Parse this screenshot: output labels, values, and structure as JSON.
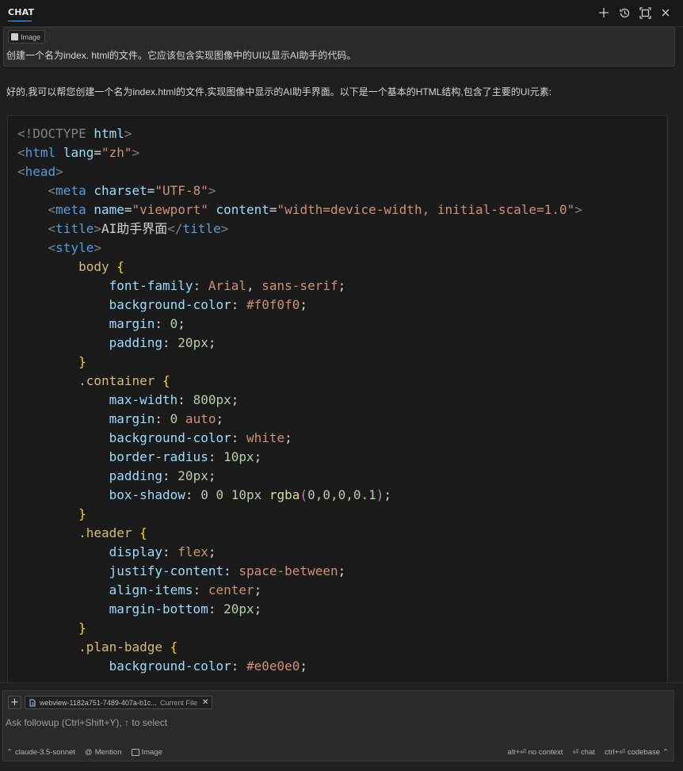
{
  "header": {
    "title": "CHAT"
  },
  "user_message": {
    "attachment_label": "Image",
    "text": "创建一个名为index. html的文件。它应该包含实现图像中的UI以显示AI助手的代码。"
  },
  "assistant": {
    "intro": "好的,我可以帮您创建一个名为index.html的文件,实现图像中显示的AI助手界面。以下是一个基本的HTML结构,包含了主要的UI元素:"
  },
  "code_lines": [
    [
      [
        "<!DOCTYPE ",
        "#808080"
      ],
      [
        "html",
        "#9cdcfe"
      ],
      [
        ">",
        "#808080"
      ]
    ],
    [
      [
        "<",
        "#808080"
      ],
      [
        "html",
        "#569cd6"
      ],
      [
        " lang",
        "#9cdcfe"
      ],
      [
        "=",
        "#d4d4d4"
      ],
      [
        "\"zh\"",
        "#ce9178"
      ],
      [
        ">",
        "#808080"
      ]
    ],
    [
      [
        "<",
        "#808080"
      ],
      [
        "head",
        "#569cd6"
      ],
      [
        ">",
        "#808080"
      ]
    ],
    [
      [
        "    <",
        "#808080"
      ],
      [
        "meta",
        "#569cd6"
      ],
      [
        " charset",
        "#9cdcfe"
      ],
      [
        "=",
        "#d4d4d4"
      ],
      [
        "\"UTF-8\"",
        "#ce9178"
      ],
      [
        ">",
        "#808080"
      ]
    ],
    [
      [
        "    <",
        "#808080"
      ],
      [
        "meta",
        "#569cd6"
      ],
      [
        " name",
        "#9cdcfe"
      ],
      [
        "=",
        "#d4d4d4"
      ],
      [
        "\"viewport\"",
        "#ce9178"
      ],
      [
        " content",
        "#9cdcfe"
      ],
      [
        "=",
        "#d4d4d4"
      ],
      [
        "\"width=device-width, initial-scale=1.0\"",
        "#ce9178"
      ],
      [
        ">",
        "#808080"
      ]
    ],
    [
      [
        "    <",
        "#808080"
      ],
      [
        "title",
        "#569cd6"
      ],
      [
        ">",
        "#808080"
      ],
      [
        "AI助手界面",
        "#d4d4d4"
      ],
      [
        "</",
        "#808080"
      ],
      [
        "title",
        "#569cd6"
      ],
      [
        ">",
        "#808080"
      ]
    ],
    [
      [
        "    <",
        "#808080"
      ],
      [
        "style",
        "#569cd6"
      ],
      [
        ">",
        "#808080"
      ]
    ],
    [
      [
        "        body ",
        "#d7ba7d"
      ],
      [
        "{",
        "#ffd700"
      ]
    ],
    [
      [
        "            font-family",
        "#9cdcfe"
      ],
      [
        ": ",
        "#d4d4d4"
      ],
      [
        "Arial",
        "#ce9178"
      ],
      [
        ", ",
        "#d4d4d4"
      ],
      [
        "sans-serif",
        "#ce9178"
      ],
      [
        ";",
        "#d4d4d4"
      ]
    ],
    [
      [
        "            background-color",
        "#9cdcfe"
      ],
      [
        ": ",
        "#d4d4d4"
      ],
      [
        "#f0f0f0",
        "#ce9178"
      ],
      [
        ";",
        "#d4d4d4"
      ]
    ],
    [
      [
        "            margin",
        "#9cdcfe"
      ],
      [
        ": ",
        "#d4d4d4"
      ],
      [
        "0",
        "#b5cea8"
      ],
      [
        ";",
        "#d4d4d4"
      ]
    ],
    [
      [
        "            padding",
        "#9cdcfe"
      ],
      [
        ": ",
        "#d4d4d4"
      ],
      [
        "20px",
        "#b5cea8"
      ],
      [
        ";",
        "#d4d4d4"
      ]
    ],
    [
      [
        "        }",
        "#ffd700"
      ]
    ],
    [
      [
        "        .container ",
        "#d7ba7d"
      ],
      [
        "{",
        "#ffd700"
      ]
    ],
    [
      [
        "            max-width",
        "#9cdcfe"
      ],
      [
        ": ",
        "#d4d4d4"
      ],
      [
        "800px",
        "#b5cea8"
      ],
      [
        ";",
        "#d4d4d4"
      ]
    ],
    [
      [
        "            margin",
        "#9cdcfe"
      ],
      [
        ": ",
        "#d4d4d4"
      ],
      [
        "0",
        "#b5cea8"
      ],
      [
        " auto",
        "#ce9178"
      ],
      [
        ";",
        "#d4d4d4"
      ]
    ],
    [
      [
        "            background-color",
        "#9cdcfe"
      ],
      [
        ": ",
        "#d4d4d4"
      ],
      [
        "white",
        "#ce9178"
      ],
      [
        ";",
        "#d4d4d4"
      ]
    ],
    [
      [
        "            border-radius",
        "#9cdcfe"
      ],
      [
        ": ",
        "#d4d4d4"
      ],
      [
        "10px",
        "#b5cea8"
      ],
      [
        ";",
        "#d4d4d4"
      ]
    ],
    [
      [
        "            padding",
        "#9cdcfe"
      ],
      [
        ": ",
        "#d4d4d4"
      ],
      [
        "20px",
        "#b5cea8"
      ],
      [
        ";",
        "#d4d4d4"
      ]
    ],
    [
      [
        "            box-shadow",
        "#9cdcfe"
      ],
      [
        ": ",
        "#d4d4d4"
      ],
      [
        "0 0 10px",
        "#b5cea8"
      ],
      [
        " rgba",
        "#dcdcaa"
      ],
      [
        "(",
        "#da70d6"
      ],
      [
        "0,0,0,0.1",
        "#b5cea8"
      ],
      [
        ")",
        "#da70d6"
      ],
      [
        ";",
        "#d4d4d4"
      ]
    ],
    [
      [
        "        }",
        "#ffd700"
      ]
    ],
    [
      [
        "        .header ",
        "#d7ba7d"
      ],
      [
        "{",
        "#ffd700"
      ]
    ],
    [
      [
        "            display",
        "#9cdcfe"
      ],
      [
        ": ",
        "#d4d4d4"
      ],
      [
        "flex",
        "#ce9178"
      ],
      [
        ";",
        "#d4d4d4"
      ]
    ],
    [
      [
        "            justify-content",
        "#9cdcfe"
      ],
      [
        ": ",
        "#d4d4d4"
      ],
      [
        "space-between",
        "#ce9178"
      ],
      [
        ";",
        "#d4d4d4"
      ]
    ],
    [
      [
        "            align-items",
        "#9cdcfe"
      ],
      [
        ": ",
        "#d4d4d4"
      ],
      [
        "center",
        "#ce9178"
      ],
      [
        ";",
        "#d4d4d4"
      ]
    ],
    [
      [
        "            margin-bottom",
        "#9cdcfe"
      ],
      [
        ": ",
        "#d4d4d4"
      ],
      [
        "20px",
        "#b5cea8"
      ],
      [
        ";",
        "#d4d4d4"
      ]
    ],
    [
      [
        "        }",
        "#ffd700"
      ]
    ],
    [
      [
        "        .plan-badge ",
        "#d7ba7d"
      ],
      [
        "{",
        "#ffd700"
      ]
    ],
    [
      [
        "            background-color",
        "#9cdcfe"
      ],
      [
        ": ",
        "#d4d4d4"
      ],
      [
        "#e0e0e0",
        "#ce9178"
      ],
      [
        ";",
        "#d4d4d4"
      ]
    ]
  ],
  "input": {
    "file_chip_name": "webview-1182a751-7489-407a-b1c...",
    "file_chip_tag": "Current File",
    "placeholder": "Ask followup (Ctrl+Shift+Y), ↑ to select",
    "model": "claude-3.5-sonnet",
    "mention": "Mention",
    "image": "Image",
    "no_context": "alt+⏎ no context",
    "chat": "⏎ chat",
    "codebase": "ctrl+⏎ codebase"
  },
  "icons": {
    "header": [
      "plus-icon",
      "history-icon",
      "maximize-icon",
      "close-icon"
    ]
  }
}
